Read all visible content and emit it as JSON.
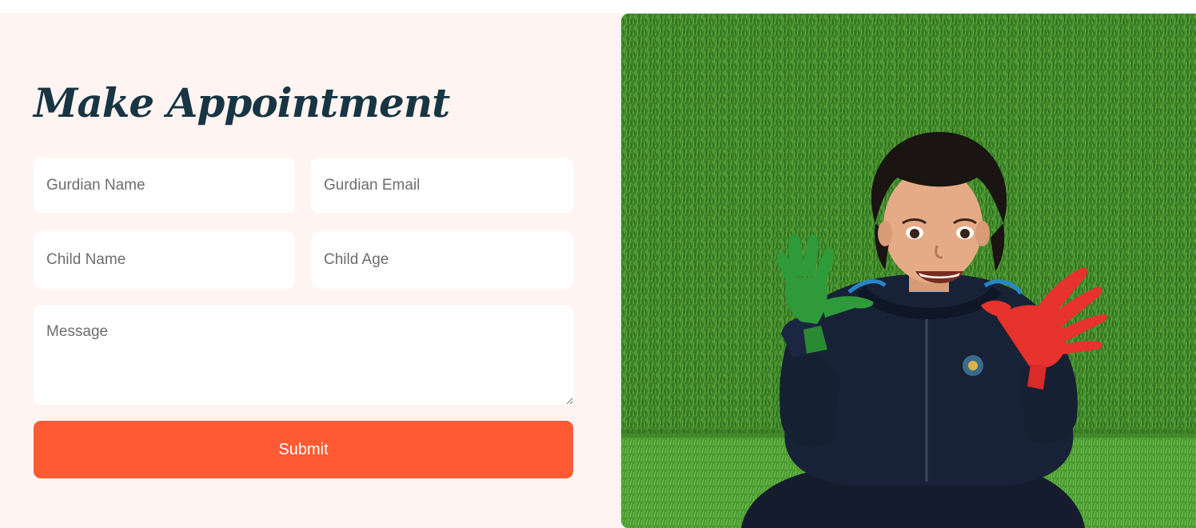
{
  "form": {
    "title": "Make Appointment",
    "guardian_name_placeholder": "Gurdian Name",
    "guardian_email_placeholder": "Gurdian Email",
    "child_name_placeholder": "Child Name",
    "child_age_placeholder": "Child Age",
    "message_placeholder": "Message",
    "submit_label": "Submit"
  },
  "colors": {
    "form_background": "#fff4f1",
    "title": "#173543",
    "submit_button": "#ff5a33",
    "grass": "#3f8a2a"
  }
}
